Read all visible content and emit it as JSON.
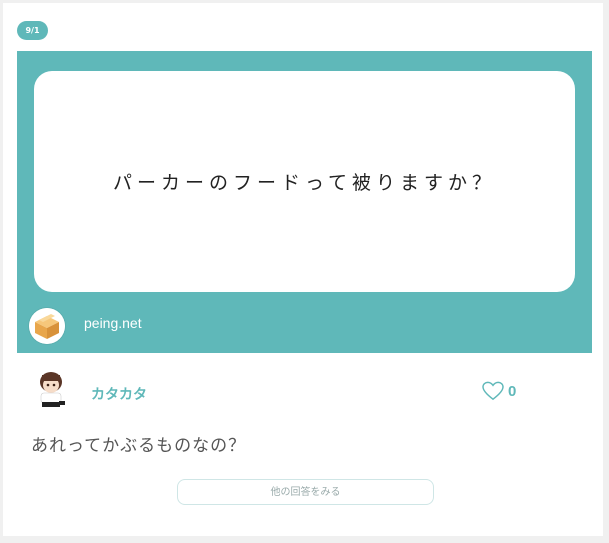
{
  "date_badge": "9/1",
  "question": {
    "text": "パーカーのフードって被りますか？",
    "site_name": "peing.net",
    "site_icon": "cardboard-box-icon"
  },
  "answer": {
    "username": "カタカタ",
    "avatar_icon": "user-avatar",
    "likes": "0",
    "like_icon": "heart-outline-icon",
    "text": "あれってかぶるものなの？"
  },
  "more_button_label": "他の回答をみる",
  "colors": {
    "accent": "#5fb8b9",
    "background": "#f0f0f0",
    "card": "#ffffff"
  }
}
